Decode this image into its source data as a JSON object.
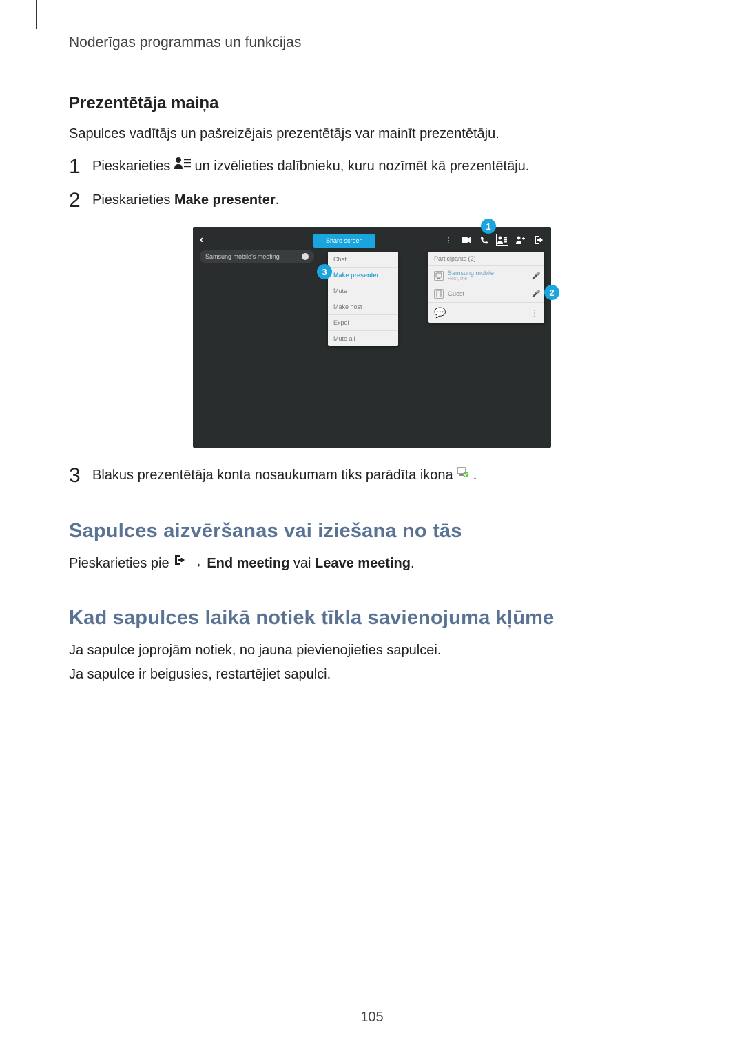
{
  "header": "Noderīgas programmas un funkcijas",
  "section1": {
    "subheading": "Prezentētāja maiņa",
    "intro": "Sapulces vadītājs un pašreizējais prezentētājs var mainīt prezentētāju.",
    "step1_pre": "Pieskarieties ",
    "step1_post": " un izvēlieties dalībnieku, kuru nozīmēt kā prezentētāju.",
    "step2_pre": "Pieskarieties ",
    "step2_bold": "Make presenter",
    "step2_post": ".",
    "step3_pre": "Blakus prezentētāja konta nosaukumam tiks parādīta ikona ",
    "step3_post": "."
  },
  "screenshot": {
    "share_btn": "Share screen",
    "meeting_label": "Samsung mobile's meeting",
    "menu": [
      "Chat",
      "Make presenter",
      "Mute",
      "Make host",
      "Expel",
      "Mute all"
    ],
    "participants_header": "Participants (2)",
    "participant1_name": "Samsung mobile",
    "participant1_sub": "Host, me",
    "participant2_name": "Guest",
    "callout1": "1",
    "callout2": "2",
    "callout3": "3"
  },
  "section2": {
    "heading": "Sapulces aizvēršanas vai iziešana no tās",
    "body_pre": "Pieskarieties pie ",
    "body_arrow": " → ",
    "body_bold1": "End meeting",
    "body_mid": " vai ",
    "body_bold2": "Leave meeting",
    "body_post": "."
  },
  "section3": {
    "heading": "Kad sapulces laikā notiek tīkla savienojuma kļūme",
    "line1": "Ja sapulce joprojām notiek, no jauna pievienojieties sapulcei.",
    "line2": "Ja sapulce ir beigusies, restartējiet sapulci."
  },
  "page_number": "105",
  "step_numbers": {
    "s1": "1",
    "s2": "2",
    "s3": "3"
  }
}
